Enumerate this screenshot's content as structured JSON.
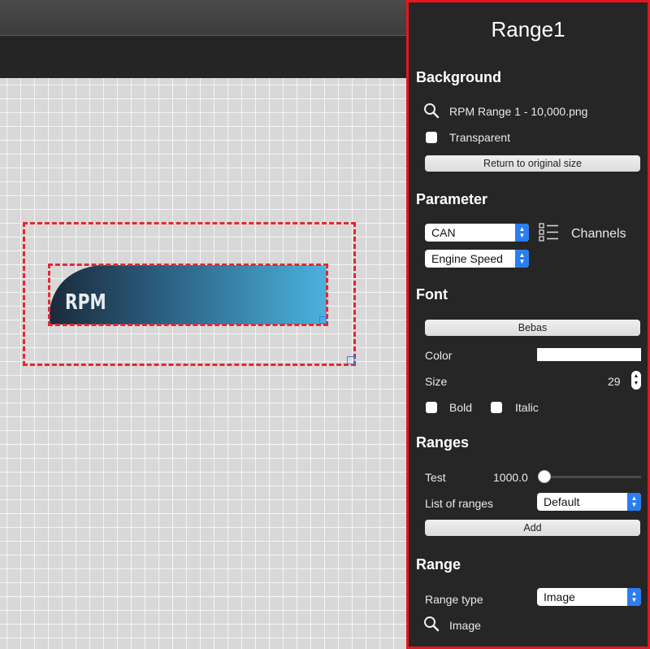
{
  "canvas": {
    "widget_text": "RPM"
  },
  "panel": {
    "title": "Range1",
    "background": {
      "heading": "Background",
      "image_file": "RPM Range 1 - 10,000.png",
      "transparent_label": "Transparent",
      "transparent_checked": false,
      "return_button": "Return to original size"
    },
    "parameter": {
      "heading": "Parameter",
      "source_value": "CAN",
      "channels_label": "Channels",
      "channel_value": "Engine Speed"
    },
    "font": {
      "heading": "Font",
      "font_button": "Bebas",
      "color_label": "Color",
      "color_value": "#ffffff",
      "size_label": "Size",
      "size_value": "29",
      "bold_label": "Bold",
      "italic_label": "Italic"
    },
    "ranges": {
      "heading": "Ranges",
      "test_label": "Test",
      "test_value": "1000.0",
      "test_slider_fraction": 0,
      "list_label": "List of ranges",
      "list_value": "Default",
      "add_button": "Add"
    },
    "range": {
      "heading": "Range",
      "type_label": "Range type",
      "type_value": "Image",
      "image_label": "Image"
    }
  },
  "colors": {
    "selection": "#e8262e",
    "panel_border": "#e8161c",
    "accent": "#2a7ef0",
    "gradient_start": "#1f3346",
    "gradient_end": "#4ab0db"
  },
  "icons": [
    "search-icon",
    "checklist-icon",
    "stepper-icon",
    "chevron-updown-icon"
  ]
}
